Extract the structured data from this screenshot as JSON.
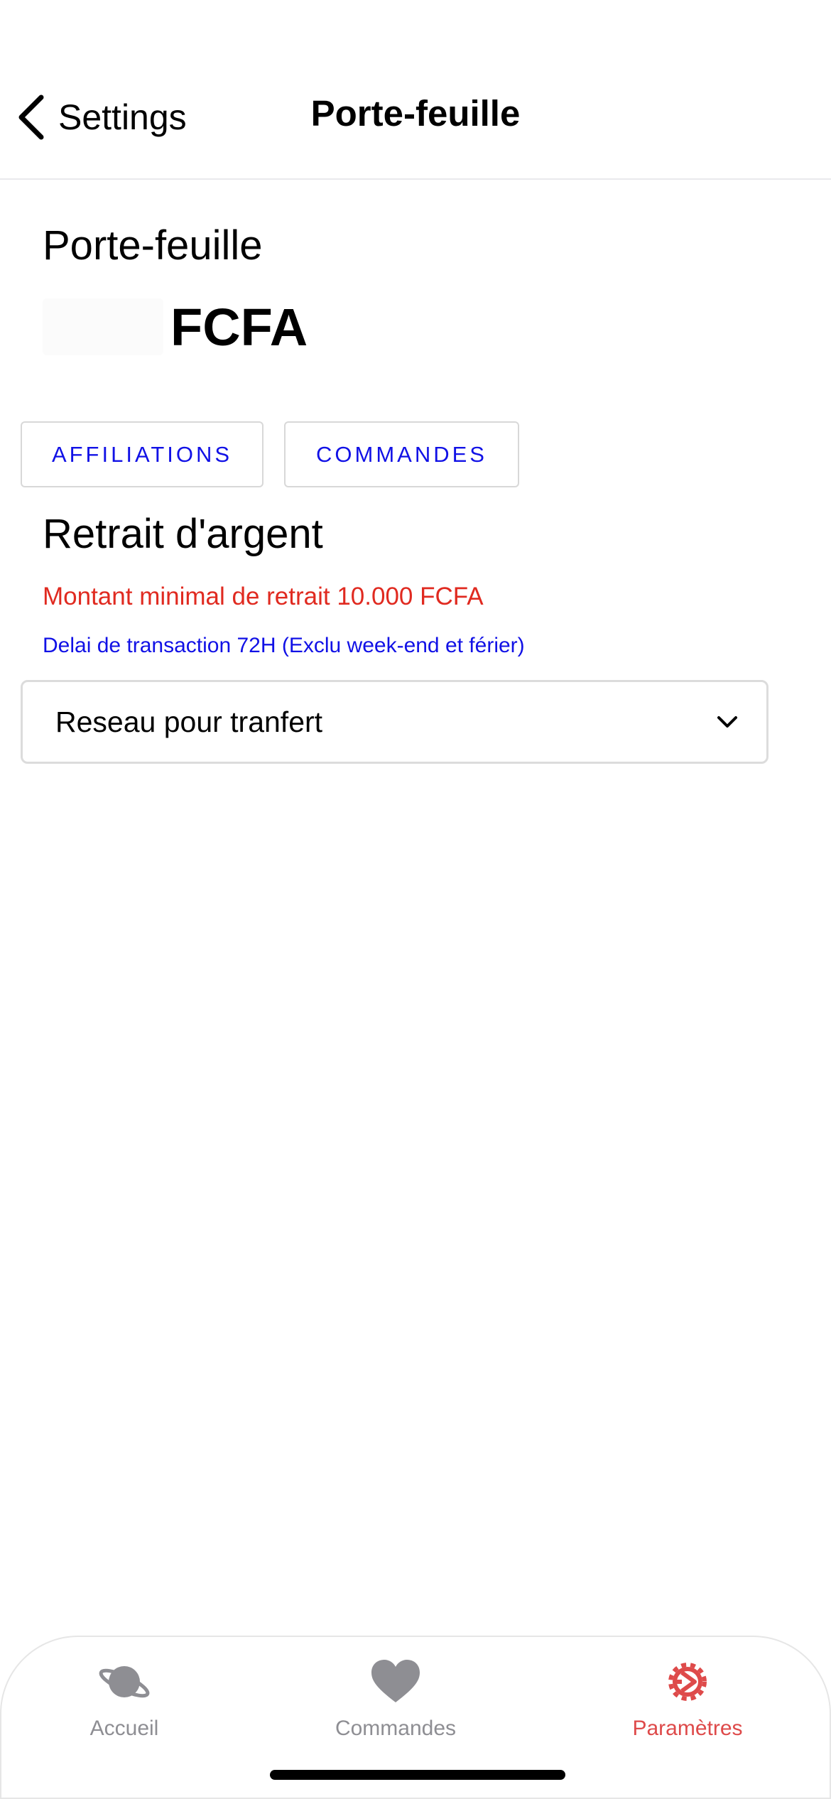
{
  "navbar": {
    "back_label": "Settings",
    "title": "Porte-feuille"
  },
  "wallet": {
    "title": "Porte-feuille",
    "amount": "***",
    "currency": "FCFA"
  },
  "tabs": [
    {
      "label": "AFFILIATIONS"
    },
    {
      "label": "COMMANDES"
    }
  ],
  "withdrawal": {
    "title": "Retrait d'argent",
    "min_amount": "Montant minimal de retrait 10.000 FCFA",
    "delay": "Delai de transaction 72H (Exclu week-end et férier)",
    "network_select": {
      "value": "Reseau pour tranfert"
    }
  },
  "tabbar": {
    "items": [
      {
        "label": "Accueil",
        "icon": "planet-icon"
      },
      {
        "label": "Commandes",
        "icon": "heart-icon"
      },
      {
        "label": "Paramètres",
        "icon": "gear-icon",
        "active": true
      }
    ]
  },
  "colors": {
    "accent_blue": "#1111e6",
    "warning_red": "#e02a20",
    "active_tab": "#de4a4a",
    "inactive_tab": "#8e8e93"
  }
}
